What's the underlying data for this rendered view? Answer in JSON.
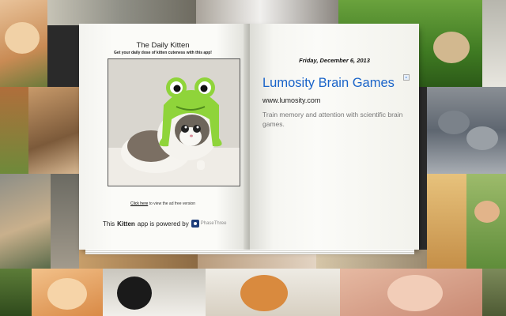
{
  "left_page": {
    "title": "The Daily Kitten",
    "subtitle": "Get your daily dose of kitten cuteness with this app!",
    "link_text": "Click here",
    "link_suffix": " to view the ad free version",
    "powered_prefix": "This ",
    "powered_app": "Kitten",
    "powered_suffix": " app is powered by",
    "brand": "PhaseThree"
  },
  "right_page": {
    "date": "Friday, December 6, 2013",
    "ad": {
      "title": "Lumosity Brain Games",
      "url": "www.lumosity.com",
      "description": "Train memory and attention with scientific brain games.",
      "choices_icon": "ad-choices-icon"
    }
  },
  "colors": {
    "ad_link": "#1a64c9",
    "brand": "#1d3d7a",
    "frog_hat": "#8fd43a"
  }
}
